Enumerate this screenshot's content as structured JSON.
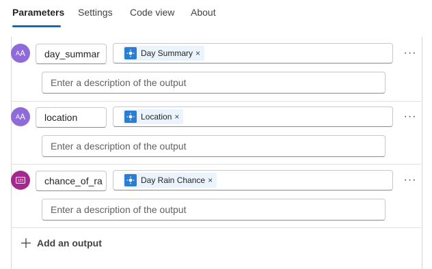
{
  "tabs": [
    {
      "label": "Parameters",
      "active": true
    },
    {
      "label": "Settings",
      "active": false
    },
    {
      "label": "Code view",
      "active": false
    },
    {
      "label": "About",
      "active": false
    }
  ],
  "outputs": [
    {
      "avatar_text": "AA",
      "name": "day_summar",
      "token_label": "Day Summary",
      "token_remove": "×",
      "more": "···",
      "description_placeholder": "Enter a description of the output"
    },
    {
      "avatar_text": "AA",
      "name": "location",
      "token_label": "Location",
      "token_remove": "×",
      "more": "···",
      "description_placeholder": "Enter a description of the output"
    },
    {
      "avatar_text": "123",
      "name": "chance_of_ra",
      "token_label": "Day Rain Chance",
      "token_remove": "×",
      "more": "···",
      "description_placeholder": "Enter a description of the output"
    }
  ],
  "add_output": {
    "icon": "plus-icon",
    "label": "Add an output"
  },
  "colors": {
    "accent": "#0f6cbd",
    "text_avatar": "#8f6bd9",
    "number_avatar": "#a4298f",
    "token_bg": "#ebf3fc",
    "token_icon": "#2b7cd3"
  }
}
